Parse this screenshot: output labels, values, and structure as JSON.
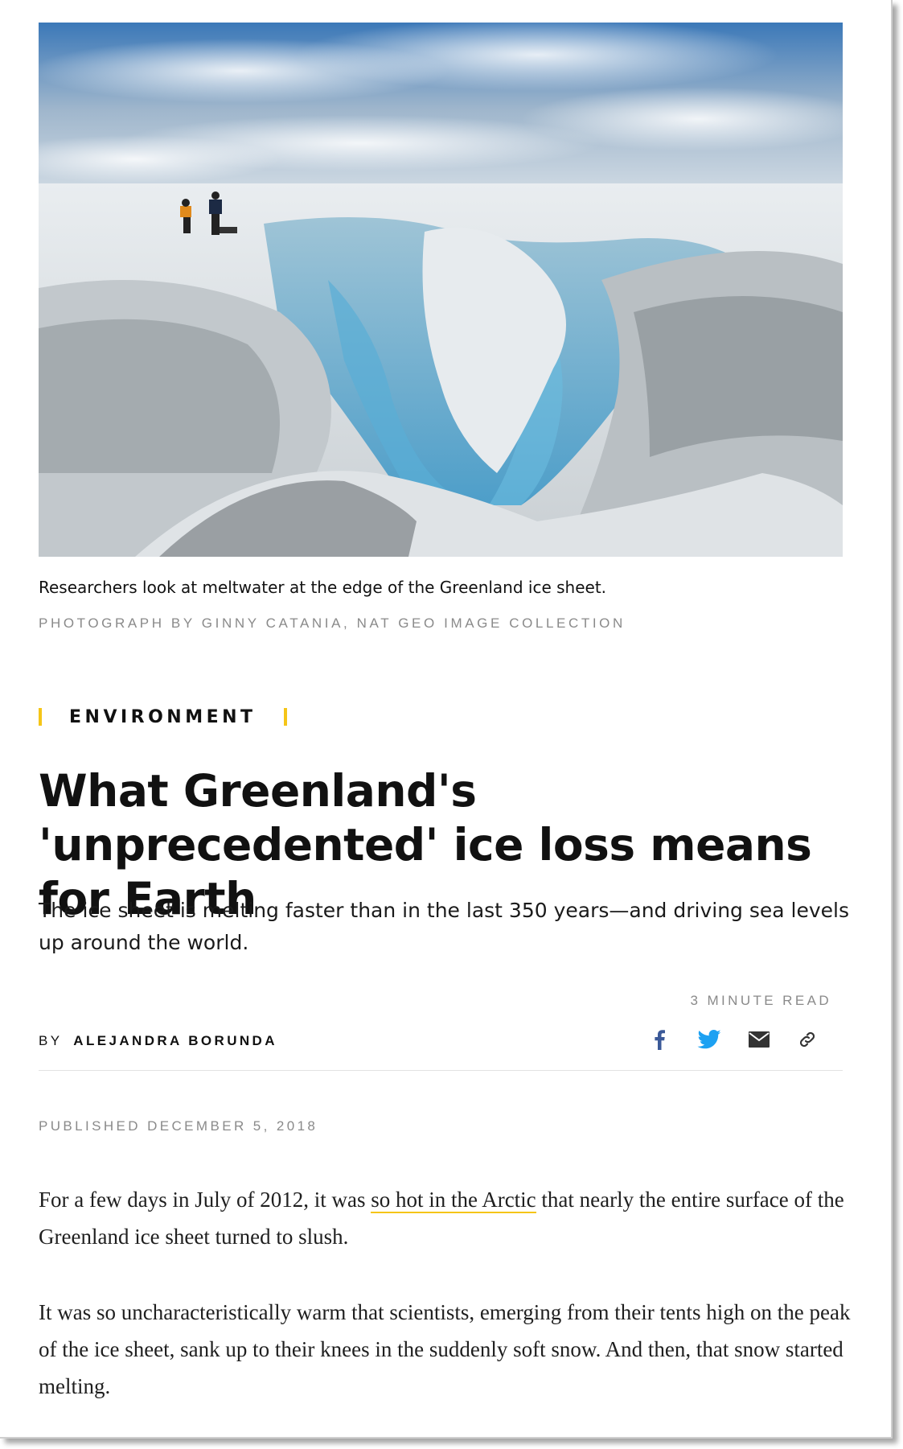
{
  "hero": {
    "alt": "Researchers look at meltwater at the edge of the Greenland ice sheet."
  },
  "caption": "Researchers look at meltwater at the edge of the Greenland ice sheet.",
  "credit": "PHOTOGRAPH BY GINNY CATANIA, NAT GEO IMAGE COLLECTION",
  "kicker": "ENVIRONMENT",
  "headline": "What Greenland's 'unprecedented' ice loss means for Earth",
  "dek": "The ice sheet is melting faster than in the last 350 years—and driving sea levels up around the world.",
  "read_time": "3 MINUTE READ",
  "byline": {
    "prefix": "BY",
    "author": "ALEJANDRA BORUNDA"
  },
  "share": {
    "icons": [
      "facebook-icon",
      "twitter-icon",
      "email-icon",
      "link-icon"
    ],
    "colors": {
      "facebook": "#3b5998",
      "twitter": "#1da1f2",
      "email": "#333333",
      "link": "#333333"
    }
  },
  "published": "PUBLISHED DECEMBER 5, 2018",
  "paragraphs": {
    "p1_before": "For a few days in July of 2012, it was ",
    "p1_link": "so hot in the Arctic",
    "p1_after": " that nearly the entire surface of the Greenland ice sheet turned to slush.",
    "p2": "It was so uncharacteristically warm that scientists, emerging from their tents high on the peak of the ice sheet, sank up to their knees in the suddenly soft snow. And then, that snow started melting."
  },
  "colors": {
    "accent": "#f5c518",
    "muted": "#8a8a8a",
    "text": "#111111"
  }
}
